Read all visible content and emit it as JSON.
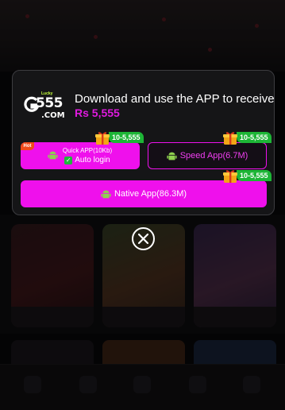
{
  "popup": {
    "logo": {
      "main": "555",
      "sub": ".COM",
      "tag": "Lucky"
    },
    "headline": "Download and use the APP to receive",
    "reward": "Rs 5,555",
    "buttons": {
      "quick": {
        "title": "Quick APP(10Kb)",
        "subtitle": "Auto login",
        "badge": "Hot",
        "reward_range": "10-5,555"
      },
      "speed": {
        "label": "Speed App(6.7M)",
        "reward_range": "10-5,555"
      },
      "native": {
        "label": "Native App(86.3M)",
        "reward_range": "10-5,555"
      }
    },
    "colors": {
      "accent": "#ef10ec",
      "reward_text": "#e01adf",
      "badge_green": "#1db536",
      "hot": "#f04a1a"
    }
  },
  "icons": {
    "android": "android-icon",
    "gift": "gift-icon",
    "close": "close-icon",
    "check": "check-icon"
  }
}
